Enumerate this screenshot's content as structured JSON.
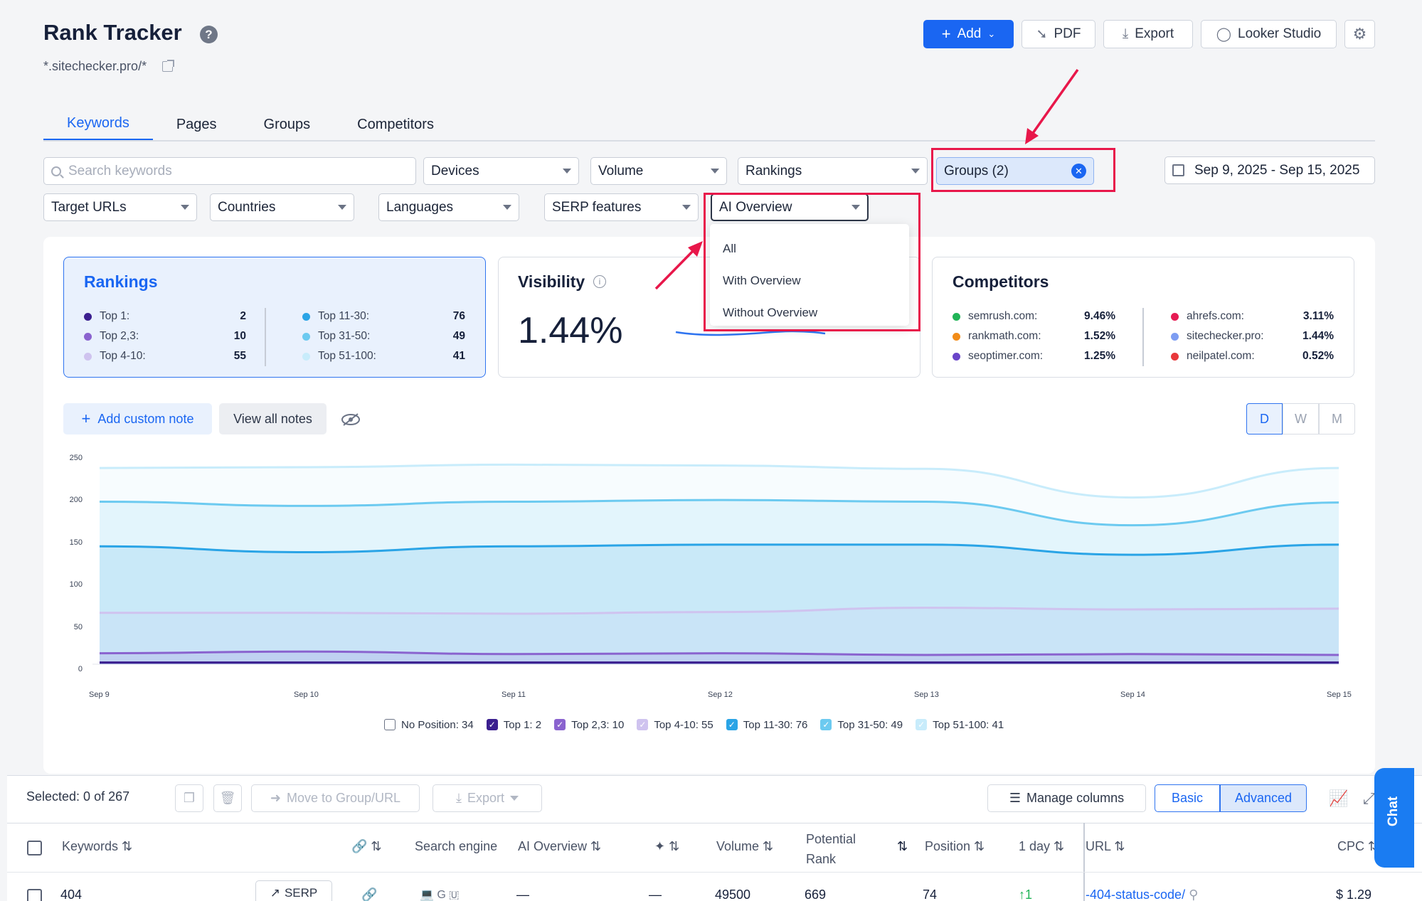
{
  "header": {
    "title": "Rank Tracker",
    "site": "*.sitechecker.pro/*",
    "add_label": "Add",
    "pdf_label": "PDF",
    "export_label": "Export",
    "looker_label": "Looker Studio"
  },
  "tabs": [
    "Keywords",
    "Pages",
    "Groups",
    "Competitors"
  ],
  "filters": {
    "search_placeholder": "Search keywords",
    "devices": "Devices",
    "volume": "Volume",
    "rankings": "Rankings",
    "groups": "Groups (2)",
    "date_range": "Sep 9, 2025 - Sep 15, 2025",
    "target_urls": "Target URLs",
    "countries": "Countries",
    "languages": "Languages",
    "serp_features": "SERP features",
    "ai_overview": "AI Overview"
  },
  "ai_overview_options": [
    "All",
    "With Overview",
    "Without Overview"
  ],
  "rankings_card": {
    "title": "Rankings",
    "left": [
      {
        "label": "Top 1:",
        "value": "2",
        "color": "#3b1f8f"
      },
      {
        "label": "Top 2,3:",
        "value": "10",
        "color": "#8a63cf"
      },
      {
        "label": "Top 4-10:",
        "value": "55",
        "color": "#cfc3ef"
      }
    ],
    "right": [
      {
        "label": "Top 11-30:",
        "value": "76",
        "color": "#2aa4e6"
      },
      {
        "label": "Top 31-50:",
        "value": "49",
        "color": "#6ccaf0"
      },
      {
        "label": "Top 51-100:",
        "value": "41",
        "color": "#c8ecfb"
      }
    ]
  },
  "visibility_card": {
    "title": "Visibility",
    "value": "1.44%"
  },
  "competitors_card": {
    "title": "Competitors",
    "left": [
      {
        "label": "semrush.com:",
        "value": "9.46%",
        "color": "#21b457"
      },
      {
        "label": "rankmath.com:",
        "value": "1.52%",
        "color": "#f28c18"
      },
      {
        "label": "seoptimer.com:",
        "value": "1.25%",
        "color": "#6a45c9"
      }
    ],
    "right": [
      {
        "label": "ahrefs.com:",
        "value": "3.11%",
        "color": "#e61b53"
      },
      {
        "label": "sitechecker.pro:",
        "value": "1.44%",
        "color": "#7d9df2"
      },
      {
        "label": "neilpatel.com:",
        "value": "0.52%",
        "color": "#e8383b"
      }
    ]
  },
  "notes": {
    "add_label": "Add custom note",
    "view_all_label": "View all notes"
  },
  "period": [
    "D",
    "W",
    "M"
  ],
  "chart_data": {
    "type": "area",
    "x": [
      "Sep 9",
      "Sep 10",
      "Sep 11",
      "Sep 12",
      "Sep 13",
      "Sep 14",
      "Sep 15"
    ],
    "yticks": [
      0,
      50,
      100,
      150,
      200,
      250
    ],
    "ylim": [
      0,
      250
    ],
    "series": [
      {
        "name": "No Position: 34",
        "checked": false,
        "color": "#ffffff",
        "values": [
          1,
          1,
          1,
          1,
          1,
          1,
          1
        ]
      },
      {
        "name": "Top 1: 2",
        "checked": true,
        "color": "#3b1f8f",
        "values": [
          2,
          2,
          2,
          2,
          2,
          2,
          2
        ]
      },
      {
        "name": "Top 2,3: 10",
        "checked": true,
        "color": "#8a63cf",
        "values": [
          13,
          15,
          12,
          13,
          11,
          12,
          11
        ]
      },
      {
        "name": "Top 4-10: 55",
        "checked": true,
        "color": "#cfc3ef",
        "values": [
          61,
          61,
          60,
          62,
          67,
          65,
          66
        ]
      },
      {
        "name": "Top 11-30: 76",
        "checked": true,
        "color": "#2aa4e6",
        "values": [
          140,
          133,
          140,
          142,
          142,
          130,
          142
        ]
      },
      {
        "name": "Top 31-50: 49",
        "checked": true,
        "color": "#6ccaf0",
        "values": [
          193,
          188,
          193,
          195,
          193,
          165,
          192
        ]
      },
      {
        "name": "Top 51-100: 41",
        "checked": true,
        "color": "#c8ecfb",
        "values": [
          233,
          234,
          237,
          236,
          232,
          198,
          233
        ]
      }
    ]
  },
  "table": {
    "selected": "Selected: 0 of 267",
    "move_label": "Move to Group/URL",
    "export_label": "Export",
    "manage_columns": "Manage columns",
    "basic": "Basic",
    "advanced": "Advanced",
    "headers": {
      "keywords": "Keywords",
      "search_engine": "Search engine",
      "ai_overview": "AI Overview",
      "volume": "Volume",
      "potential_rank_1": "Potential",
      "potential_rank_2": "Rank",
      "position": "Position",
      "one_day": "1 day",
      "url": "URL",
      "cpc": "CPC"
    },
    "row": {
      "keyword": "404",
      "serp": "SERP",
      "ai_overview": "—",
      "sparkle": "—",
      "volume": "49500",
      "potential_rank": "669",
      "position": "74",
      "one_day": "1",
      "url": "-404-status-code/",
      "cpc": "$ 1.29"
    }
  },
  "chat_label": "Chat"
}
